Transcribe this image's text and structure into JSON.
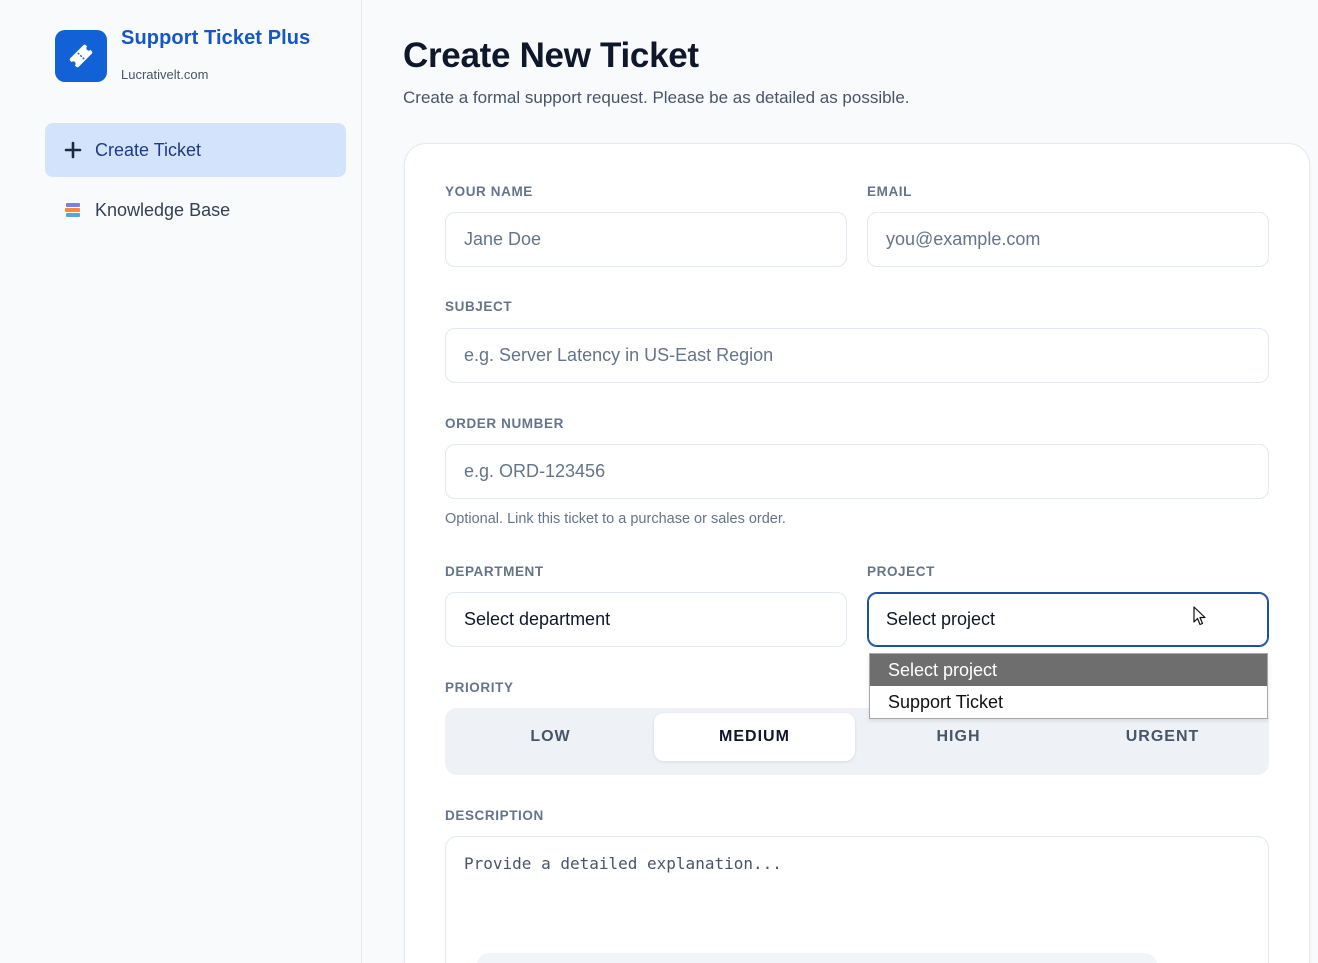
{
  "sidebar": {
    "brand_name": "Support Ticket Plus",
    "brand_domain": "Lucrativelt.com",
    "items": [
      {
        "label": "Create Ticket",
        "icon": "plus-icon",
        "active": true
      },
      {
        "label": "Knowledge Base",
        "icon": "books-icon",
        "active": false
      }
    ]
  },
  "header": {
    "title": "Create New Ticket",
    "subtitle": "Create a formal support request. Please be as detailed as possible."
  },
  "form": {
    "name": {
      "label": "YOUR NAME",
      "value": "",
      "placeholder": "Jane Doe"
    },
    "email": {
      "label": "EMAIL",
      "value": "",
      "placeholder": "you@example.com"
    },
    "subject": {
      "label": "SUBJECT",
      "value": "",
      "placeholder": "e.g. Server Latency in US-East Region"
    },
    "order": {
      "label": "ORDER NUMBER",
      "value": "",
      "placeholder": "e.g. ORD-123456",
      "helper": "Optional. Link this ticket to a purchase or sales order."
    },
    "department": {
      "label": "DEPARTMENT",
      "value": "Select department"
    },
    "project": {
      "label": "PROJECT",
      "value": "Select project",
      "options": [
        "Select project",
        "Support Ticket"
      ]
    },
    "priority": {
      "label": "PRIORITY",
      "options": [
        "LOW",
        "MEDIUM",
        "HIGH",
        "URGENT"
      ],
      "selected": "MEDIUM"
    },
    "description": {
      "label": "DESCRIPTION",
      "placeholder": "Provide a detailed explanation..."
    }
  },
  "colors": {
    "accent": "#1261d6",
    "active_nav_bg": "#d3e3fb"
  }
}
